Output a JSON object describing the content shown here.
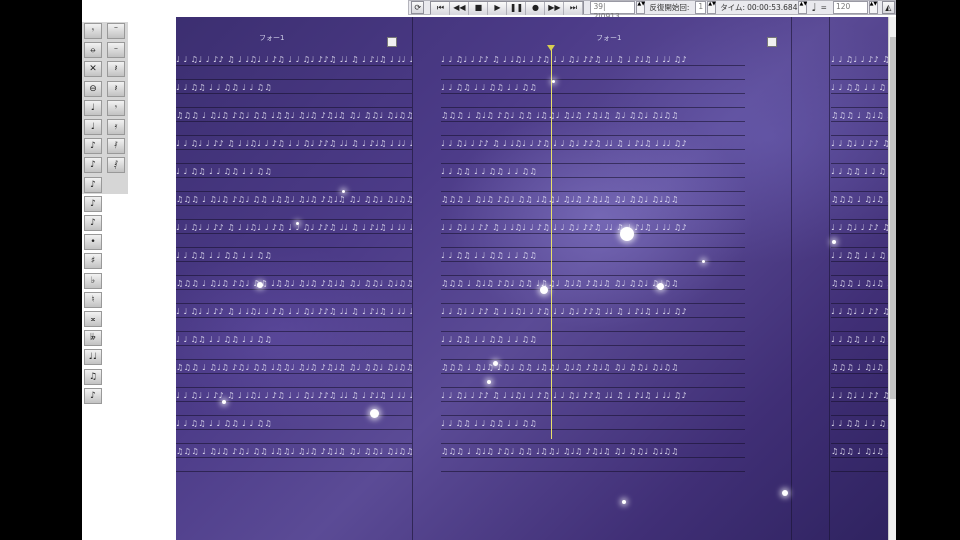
{
  "toolbar": {
    "position_value": "39| 2|0913",
    "playback_start_label": "反復開始回:",
    "playback_start_value": "1",
    "time_label": "タイム:",
    "time_value": "00:00:53.684",
    "tempo_value": "120",
    "transport": [
      "⏮",
      "◀◀",
      "■",
      "▶",
      "❚❚",
      "●",
      "▶▶",
      "⏭"
    ]
  },
  "palette": {
    "left_col": [
      "𝄾",
      "⦵",
      "✕",
      "⊖",
      "♩",
      "♩",
      "♪",
      "♪",
      "♪",
      "♪",
      "♪",
      "•",
      "♯",
      "♭",
      "♮",
      "𝄪",
      "𝄫",
      "♩♩",
      "♫",
      "♪"
    ],
    "right_col": [
      "𝄻",
      "𝄼",
      "𝄽",
      "𝄽",
      "𝄾",
      "𝄿",
      "𝅀",
      "𝅁"
    ]
  },
  "score": {
    "page1_label": "フォー1",
    "page2_label": "フォー1",
    "notes_a": "♩ ♩ ♫♩ ♩ ♪♪ ♫ ♩ ♩♫♩ ♩ ♪♫ ♩ ♩ ♫♩ ♪♪♫ ♩♩ ♫ ♩ ♪♩♫ ♩ ♩♩ ♫♪",
    "notes_b": "♫♫♫ ♩ ♫♩♫ ♪♫♩ ♫♫ ♩♫♫♩ ♫♩♫ ♪♫♩♫ ♫♩ ♫♫♩ ♫♩♫♫",
    "notes_c": "♩ ♩ ♫♫   ♩ ♩ ♫♫   ♩ ♩ ♫♫"
  },
  "colors": {
    "cursor": "#e8e06a",
    "background_purple": "#4c3b88"
  }
}
